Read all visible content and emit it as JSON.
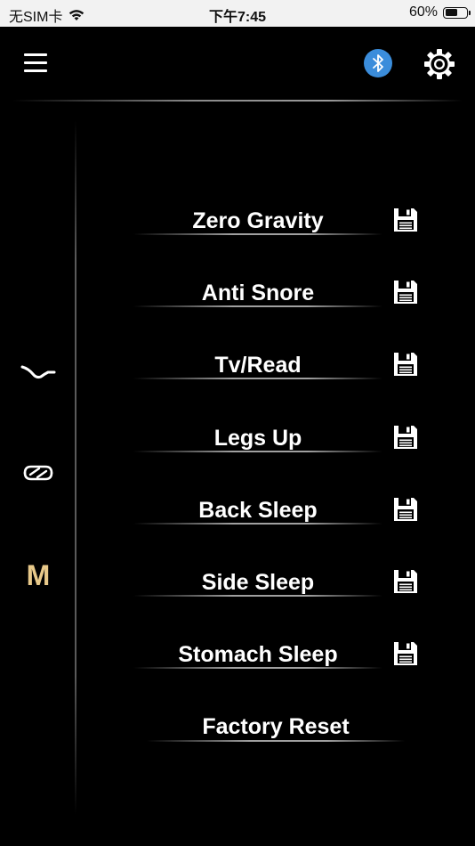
{
  "status_bar": {
    "carrier": "无SIM卡",
    "time": "下午7:45",
    "battery_percent": "60%",
    "battery_level": 0.6
  },
  "header": {
    "menu_icon": "hamburger-menu-icon",
    "bluetooth_icon": "bluetooth-icon",
    "settings_icon": "gear-icon",
    "bluetooth_color": "#3b8ddb"
  },
  "side_modes": {
    "first_icon": "wave-curve-icon",
    "second_icon": "loop-arrows-icon",
    "memory_label": "M",
    "memory_color": "#e8c98a"
  },
  "presets": [
    {
      "label": "Zero Gravity",
      "save_icon": "save-disk-icon"
    },
    {
      "label": "Anti Snore",
      "save_icon": "save-disk-icon"
    },
    {
      "label": "Tv/Read",
      "save_icon": "save-disk-icon"
    },
    {
      "label": "Legs Up",
      "save_icon": "save-disk-icon"
    },
    {
      "label": "Back Sleep",
      "save_icon": "save-disk-icon"
    },
    {
      "label": "Side Sleep",
      "save_icon": "save-disk-icon"
    },
    {
      "label": "Stomach Sleep",
      "save_icon": "save-disk-icon"
    }
  ],
  "factory_reset": {
    "label": "Factory Reset"
  }
}
